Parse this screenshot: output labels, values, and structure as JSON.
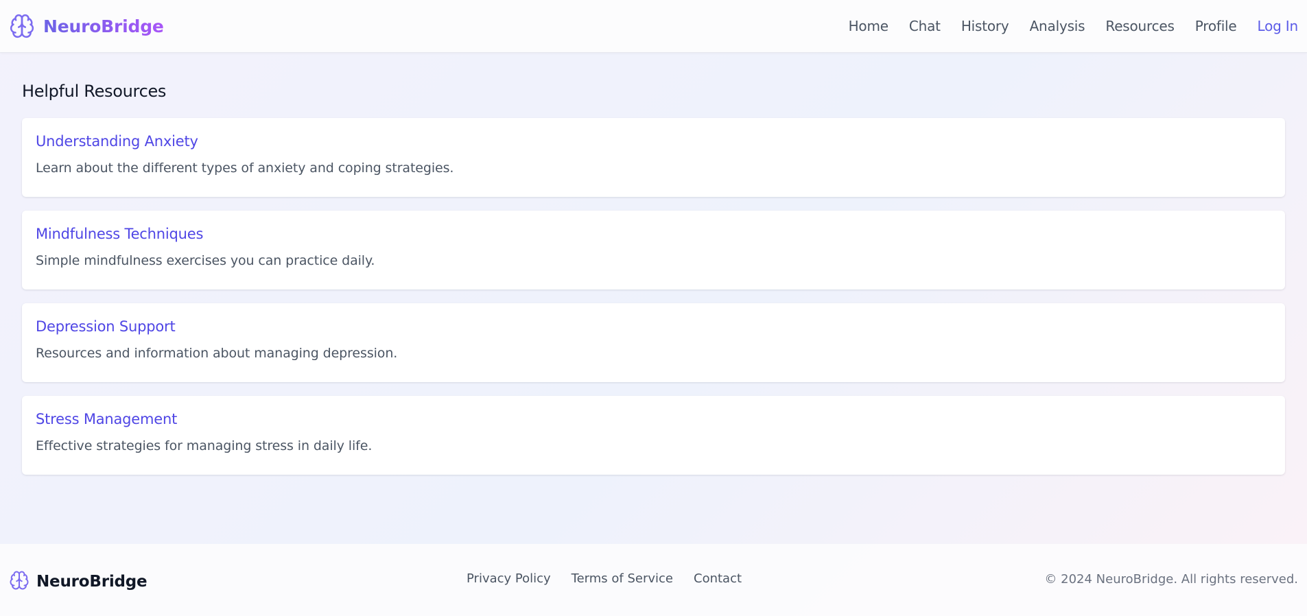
{
  "header": {
    "brand": "NeuroBridge",
    "logo_icon": "brain-icon",
    "nav": [
      {
        "label": "Home"
      },
      {
        "label": "Chat"
      },
      {
        "label": "History"
      },
      {
        "label": "Analysis"
      },
      {
        "label": "Resources"
      },
      {
        "label": "Profile"
      },
      {
        "label": "Log In"
      }
    ]
  },
  "main": {
    "title": "Helpful Resources",
    "resources": [
      {
        "title": "Understanding Anxiety",
        "description": "Learn about the different types of anxiety and coping strategies."
      },
      {
        "title": "Mindfulness Techniques",
        "description": "Simple mindfulness exercises you can practice daily."
      },
      {
        "title": "Depression Support",
        "description": "Resources and information about managing depression."
      },
      {
        "title": "Stress Management",
        "description": "Effective strategies for managing stress in daily life."
      }
    ]
  },
  "footer": {
    "brand": "NeuroBridge",
    "links": [
      {
        "label": "Privacy Policy"
      },
      {
        "label": "Terms of Service"
      },
      {
        "label": "Contact"
      }
    ],
    "copyright": "© 2024 NeuroBridge. All rights reserved."
  },
  "colors": {
    "accent": "#4f46e5",
    "brand_gradient_start": "#6c63e6",
    "brand_gradient_end": "#a855f7",
    "text_muted": "#4b5563"
  }
}
